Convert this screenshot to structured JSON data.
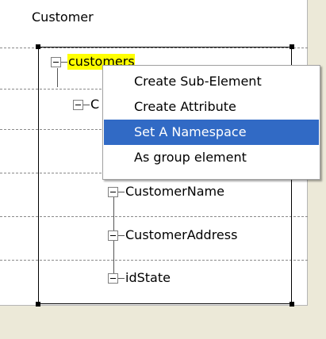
{
  "diagram": {
    "title": "Customer"
  },
  "tree": {
    "root": "customers",
    "child_partial": "C",
    "fields": [
      "CustomerName",
      "CustomerAddress",
      "idState"
    ]
  },
  "context_menu": {
    "items": [
      {
        "label": "Create Sub-Element",
        "selected": false
      },
      {
        "label": "Create Attribute",
        "selected": false
      },
      {
        "label": "Set A Namespace",
        "selected": true
      },
      {
        "label": "As group element",
        "selected": false
      }
    ]
  },
  "colors": {
    "highlight": "#ffff00",
    "selection": "#316ac5"
  }
}
